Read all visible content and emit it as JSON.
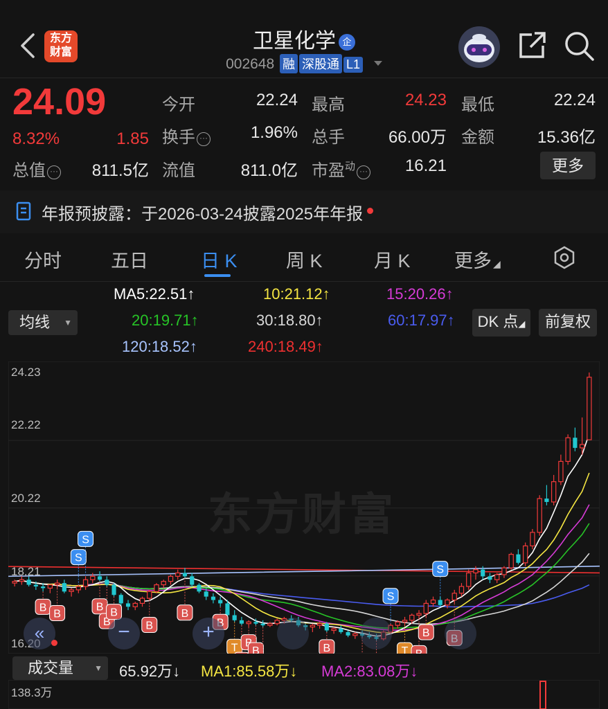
{
  "header": {
    "title": "卫星化学",
    "title_badge": "企",
    "code": "002648",
    "tags": [
      "融",
      "深股通",
      "L1"
    ],
    "logo_text_1": "东方",
    "logo_text_2": "财富"
  },
  "quote": {
    "price": "24.09",
    "change_pct": "8.32%",
    "change": "1.85",
    "rows": [
      {
        "label": "今开",
        "value": "22.24"
      },
      {
        "label": "最高",
        "value": "24.23"
      },
      {
        "label": "最低",
        "value": "22.24"
      },
      {
        "label": "换手",
        "value": "1.96%"
      },
      {
        "label": "总手",
        "value": "66.00万"
      },
      {
        "label": "金额",
        "value": "15.36亿"
      },
      {
        "label": "总值",
        "value": "811.5亿"
      },
      {
        "label": "流值",
        "value": "811.0亿"
      },
      {
        "label": "市盈",
        "label_sup": "动",
        "value": "16.21"
      }
    ],
    "more_label": "更多"
  },
  "notice": {
    "text": "年报预披露：于2026-03-24披露2025年年报"
  },
  "tabs": [
    {
      "label": "分时"
    },
    {
      "label": "五日"
    },
    {
      "label": "日 K"
    },
    {
      "label": "周 K"
    },
    {
      "label": "月 K"
    },
    {
      "label": "更多"
    }
  ],
  "ma_panel": {
    "selector": "均线",
    "dk_label": "DK 点",
    "fq_label": "前复权",
    "items": [
      {
        "text": "MA5:22.51",
        "color": "#ffffff"
      },
      {
        "text": "10:21.12",
        "color": "#f5e642"
      },
      {
        "text": "15:20.26",
        "color": "#d63bd6"
      },
      {
        "text": "20:19.71",
        "color": "#27c427"
      },
      {
        "text": "30:18.80",
        "color": "#d8d8d8"
      },
      {
        "text": "60:17.97",
        "color": "#4a5cf0"
      },
      {
        "text": "120:18.52",
        "color": "#a8c4ff"
      },
      {
        "text": "240:18.49",
        "color": "#ee3030"
      }
    ]
  },
  "chart": {
    "y_labels": [
      "24.23",
      "22.22",
      "20.22",
      "18.21",
      "16.20"
    ],
    "watermark": "东方财富"
  },
  "chart_data": {
    "type": "candlestick",
    "ylim": [
      16.2,
      24.23
    ],
    "ohlc": [
      [
        18.0,
        18.1,
        17.9,
        18.05
      ],
      [
        18.05,
        18.2,
        17.95,
        18.1
      ],
      [
        18.1,
        18.2,
        17.9,
        17.95
      ],
      [
        17.95,
        18.05,
        17.8,
        17.9
      ],
      [
        17.9,
        18.0,
        17.75,
        17.85
      ],
      [
        17.85,
        17.95,
        17.7,
        17.95
      ],
      [
        17.95,
        18.1,
        17.85,
        18.0
      ],
      [
        18.0,
        18.1,
        17.7,
        17.75
      ],
      [
        17.75,
        17.85,
        17.6,
        17.8
      ],
      [
        17.8,
        17.95,
        17.7,
        17.9
      ],
      [
        17.9,
        18.2,
        17.8,
        18.1
      ],
      [
        18.1,
        18.3,
        18.0,
        18.2
      ],
      [
        18.2,
        18.35,
        18.05,
        18.1
      ],
      [
        18.1,
        18.2,
        17.9,
        17.95
      ],
      [
        17.95,
        18.0,
        17.6,
        17.65
      ],
      [
        17.65,
        17.7,
        17.3,
        17.4
      ],
      [
        17.4,
        17.5,
        17.2,
        17.3
      ],
      [
        17.3,
        17.45,
        17.2,
        17.4
      ],
      [
        17.4,
        17.6,
        17.3,
        17.55
      ],
      [
        17.55,
        17.8,
        17.5,
        17.75
      ],
      [
        17.75,
        18.0,
        17.7,
        17.95
      ],
      [
        17.95,
        18.1,
        17.85,
        18.05
      ],
      [
        18.05,
        18.25,
        17.95,
        18.2
      ],
      [
        18.2,
        18.4,
        18.1,
        18.3
      ],
      [
        18.3,
        18.45,
        18.15,
        18.2
      ],
      [
        18.2,
        18.3,
        17.9,
        17.95
      ],
      [
        17.95,
        18.0,
        17.7,
        17.75
      ],
      [
        17.75,
        17.85,
        17.5,
        17.6
      ],
      [
        17.6,
        17.7,
        17.4,
        17.5
      ],
      [
        17.5,
        17.6,
        17.3,
        17.4
      ],
      [
        17.4,
        17.5,
        16.95,
        17.05
      ],
      [
        17.05,
        17.2,
        16.85,
        16.9
      ],
      [
        16.9,
        17.0,
        16.75,
        16.8
      ],
      [
        16.8,
        16.9,
        16.7,
        16.85
      ],
      [
        16.85,
        16.95,
        16.75,
        16.8
      ],
      [
        16.8,
        16.9,
        16.7,
        16.75
      ],
      [
        16.75,
        16.85,
        16.7,
        16.8
      ],
      [
        16.8,
        16.95,
        16.75,
        16.9
      ],
      [
        16.9,
        17.0,
        16.8,
        16.95
      ],
      [
        16.95,
        17.05,
        16.85,
        16.9
      ],
      [
        16.9,
        17.0,
        16.7,
        16.75
      ],
      [
        16.75,
        16.8,
        16.6,
        16.7
      ],
      [
        16.7,
        16.8,
        16.55,
        16.75
      ],
      [
        16.75,
        16.85,
        16.65,
        16.8
      ],
      [
        16.8,
        16.85,
        16.55,
        16.6
      ],
      [
        16.6,
        16.7,
        16.5,
        16.65
      ],
      [
        16.65,
        16.75,
        16.5,
        16.55
      ],
      [
        16.55,
        16.6,
        16.4,
        16.45
      ],
      [
        16.45,
        16.55,
        16.35,
        16.5
      ],
      [
        16.5,
        16.6,
        16.4,
        16.45
      ],
      [
        16.45,
        16.55,
        16.35,
        16.4
      ],
      [
        16.4,
        16.5,
        16.3,
        16.35
      ],
      [
        16.35,
        16.6,
        16.3,
        16.55
      ],
      [
        16.55,
        16.8,
        16.5,
        16.75
      ],
      [
        16.75,
        16.9,
        16.65,
        16.85
      ],
      [
        16.85,
        17.0,
        16.75,
        16.9
      ],
      [
        16.9,
        17.1,
        16.8,
        17.05
      ],
      [
        17.05,
        17.2,
        16.95,
        17.1
      ],
      [
        17.1,
        17.5,
        17.0,
        17.4
      ],
      [
        17.4,
        17.6,
        17.3,
        17.5
      ],
      [
        17.5,
        17.6,
        17.3,
        17.35
      ],
      [
        17.35,
        17.55,
        17.25,
        17.5
      ],
      [
        17.5,
        17.8,
        17.4,
        17.7
      ],
      [
        17.7,
        18.0,
        17.6,
        17.9
      ],
      [
        17.9,
        18.4,
        17.8,
        18.3
      ],
      [
        18.3,
        18.5,
        18.1,
        18.4
      ],
      [
        18.4,
        18.5,
        18.1,
        18.2
      ],
      [
        18.2,
        18.3,
        18.0,
        18.1
      ],
      [
        18.1,
        18.3,
        18.0,
        18.25
      ],
      [
        18.25,
        18.5,
        18.15,
        18.45
      ],
      [
        18.45,
        18.9,
        18.4,
        18.85
      ],
      [
        18.85,
        19.0,
        18.55,
        18.6
      ],
      [
        18.6,
        19.2,
        18.5,
        19.1
      ],
      [
        19.1,
        19.6,
        19.0,
        19.5
      ],
      [
        19.5,
        20.6,
        19.4,
        20.5
      ],
      [
        20.5,
        20.9,
        20.3,
        20.4
      ],
      [
        20.4,
        21.2,
        20.3,
        21.0
      ],
      [
        21.0,
        21.8,
        20.9,
        21.6
      ],
      [
        21.6,
        22.4,
        21.5,
        22.3
      ],
      [
        22.3,
        22.6,
        21.9,
        22.0
      ],
      [
        22.0,
        22.9,
        21.8,
        22.1
      ],
      [
        22.24,
        24.23,
        22.24,
        24.09
      ]
    ],
    "markers": [
      {
        "label": "B",
        "i": 4
      },
      {
        "label": "B",
        "i": 6
      },
      {
        "label": "S",
        "i": 9
      },
      {
        "label": "S",
        "i": 10
      },
      {
        "label": "B",
        "i": 12
      },
      {
        "label": "B",
        "i": 13
      },
      {
        "label": "B",
        "i": 14
      },
      {
        "label": "B",
        "i": 19
      },
      {
        "label": "B",
        "i": 24
      },
      {
        "label": "B",
        "i": 29
      },
      {
        "label": "T",
        "i": 31
      },
      {
        "label": "B",
        "i": 32
      },
      {
        "label": "B",
        "i": 33
      },
      {
        "label": "B",
        "i": 34
      },
      {
        "label": "B",
        "i": 35
      },
      {
        "label": "B",
        "i": 44
      },
      {
        "label": "B",
        "i": 49
      },
      {
        "label": "B",
        "i": 51
      },
      {
        "label": "S",
        "i": 53
      },
      {
        "label": "T",
        "i": 55
      },
      {
        "label": "B",
        "i": 57
      },
      {
        "label": "B",
        "i": 58
      },
      {
        "label": "S",
        "i": 60
      },
      {
        "label": "B",
        "i": 62
      }
    ]
  },
  "volume": {
    "selector": "成交量",
    "vol": "65.92万",
    "ma1": "MA1:85.58万",
    "ma2": "MA2:83.08万",
    "vol_arrow": "↓",
    "ma1_arrow": "↓",
    "ma2_arrow": "↓",
    "y_max": "138.3万"
  }
}
